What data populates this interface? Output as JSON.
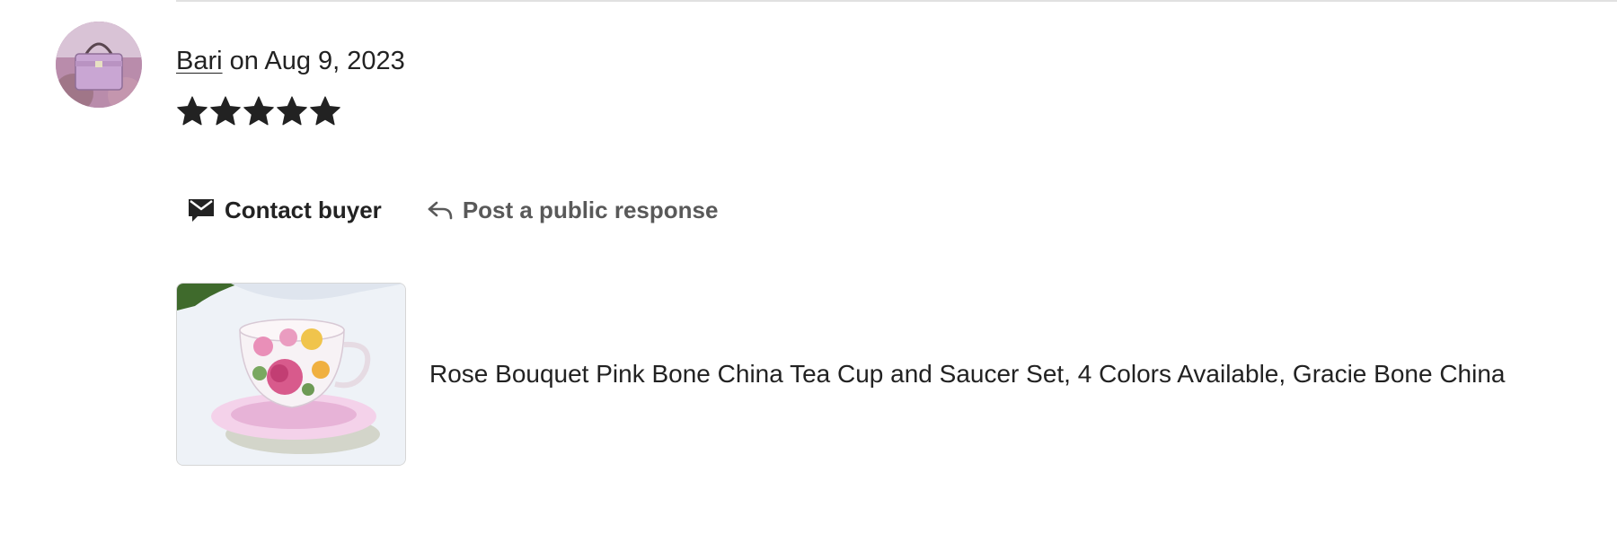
{
  "review": {
    "author": "Bari",
    "date_text": " on Aug 9, 2023",
    "rating": 5,
    "rating_max": 5
  },
  "actions": {
    "contact_label": "Contact buyer",
    "respond_label": "Post a public response"
  },
  "listing": {
    "title": "Rose Bouquet Pink Bone China Tea Cup and Saucer Set, 4 Colors Available, Gracie Bone China"
  },
  "icons": {
    "contact": "envelope-speech-icon",
    "respond": "reply-arrow-icon",
    "star": "star-icon"
  },
  "colors": {
    "text": "#222222",
    "muted": "#595959",
    "divider": "#e1e1e1"
  }
}
